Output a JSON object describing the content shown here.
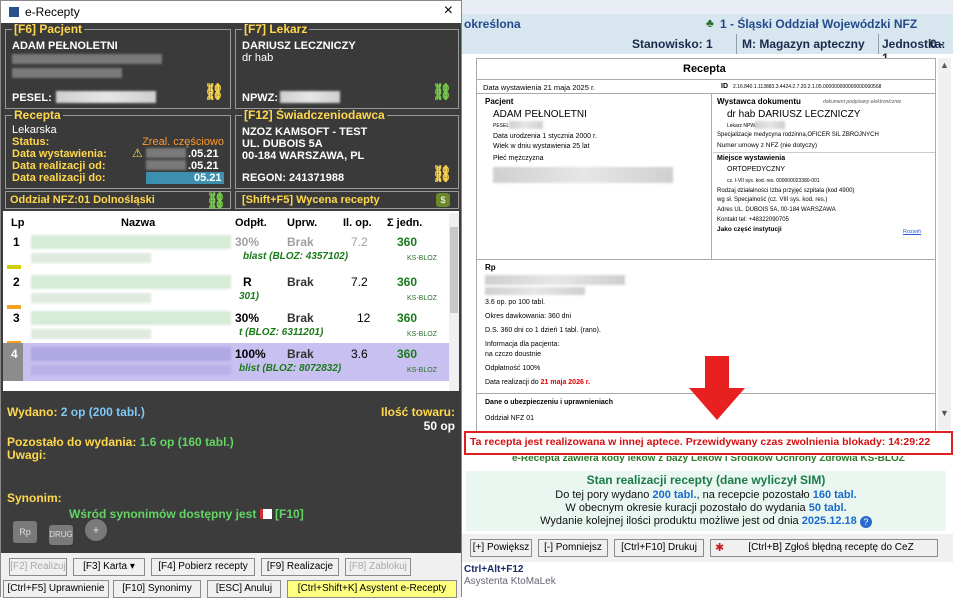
{
  "window": {
    "title": "e-Recepty",
    "close": "×"
  },
  "pacjent": {
    "legend": "[F6] Pacjent",
    "name": "ADAM PEŁNOLETNI",
    "pesel_label": "PESEL:"
  },
  "lekarz": {
    "legend": "[F7] Lekarz",
    "name": "DARIUSZ LECZNICZY",
    "title": "dr hab",
    "npwz_label": "NPWZ:"
  },
  "recepta": {
    "legend": "Recepta",
    "type": "Lekarska",
    "status_label": "Status:",
    "status_value": "Zreal. częściowo",
    "wystawienia_label": "Data wystawienia:",
    "wystawienia_value": ".05.21",
    "od_label": "Data realizacji od:",
    "od_value": ".05.21",
    "do_label": "Data realizacji do:",
    "do_value": "05.21"
  },
  "swiadczeniodawca": {
    "legend": "[F12] Świadczeniodawca",
    "name": "NZOZ KAMSOFT - TEST",
    "street": "UL. DUBOIS 5A",
    "city": "00-184 WARSZAWA, PL",
    "regon": "REGON: 241371988"
  },
  "oddzial": {
    "label": "Oddział NFZ:01 Dolnośląski"
  },
  "wycena": {
    "label": "[Shift+F5] Wycena recepty"
  },
  "table": {
    "headers": {
      "lp": "Lp",
      "nazwa": "Nazwa",
      "odplt": "Odpłt.",
      "uprw": "Uprw.",
      "ilop": "Il. op.",
      "sjedn": "Σ jedn."
    },
    "rows": [
      {
        "lp": "1",
        "odplt": "30%",
        "uprw": "Brak",
        "ilop": "7.2",
        "sjedn": "360",
        "sub": "blast (BLOZ: 4357102)",
        "bloz": "KS-BLOZ"
      },
      {
        "lp": "2",
        "odplt": "R",
        "uprw": "Brak",
        "ilop": "7.2",
        "sjedn": "360",
        "sub": "301)",
        "bloz": "KS-BLOZ"
      },
      {
        "lp": "3",
        "odplt": "30%",
        "uprw": "Brak",
        "ilop": "12",
        "sjedn": "360",
        "sub": "t (BLOZ: 6311201)",
        "bloz": "KS-BLOZ"
      },
      {
        "lp": "4",
        "odplt": "100%",
        "uprw": "Brak",
        "ilop": "3.6",
        "sjedn": "360",
        "sub": "blist (BLOZ: 8072832)",
        "bloz": "KS-BLOZ"
      }
    ]
  },
  "summary": {
    "wydano_label": "Wydano:",
    "wydano_value": "2 op (200 tabl.)",
    "ilosc_label": "Ilość towaru:",
    "ilosc_value": "50 op",
    "pozostalo_label": "Pozostało do wydania:",
    "pozostalo_value": "1.6 op (160 tabl.)",
    "uwagi_label": "Uwagi:",
    "synonim_label": "Synonim:",
    "synonim_text": "Wśród synonimów dostępny jest",
    "synonim_key": "[F10]"
  },
  "buttons_row1": [
    "[F2] Realizuj",
    "[F3] Karta ▾",
    "[F4] Pobierz recepty",
    "[F9] Realizacje",
    "[F8] Zablokuj"
  ],
  "buttons_row2": [
    "[Ctrl+F5] Uprawnienie",
    "[F10] Synonimy",
    "[ESC] Anuluj",
    "[Ctrl+Shift+K] Asystent e-Recepty"
  ],
  "right": {
    "hdr_left": "określona",
    "hdr_nfz": "1 - Śląski Oddział Wojewódzki NFZ",
    "stanowisko": "Stanowisko: 1",
    "magazyn": "M: Magazyn apteczny",
    "jednostka": "Jednostka: 1",
    "jednostka_tail": "0 -"
  },
  "doc": {
    "title": "Recepta",
    "data_wyst": "Data wystawienia 21 maja 2025 r.",
    "id_label": "ID",
    "id_value": "2.16.840.1.113883.3.4424.2.7.20.2.1.05.000000000000000000568",
    "pacjent_h": "Pacjent",
    "pacjent_name": "ADAM PEŁNOLETNI",
    "pesel": "PESEL",
    "ur": "Data urodzenia 1 stycznia 2000 r.",
    "wiek": "Wiek w dniu wystawienia 25 lat",
    "plec": "Płeć mężczyzna",
    "wyst_h": "Wystawca dokumentu",
    "wyst_sig": "dokument podpisany elektronicznie",
    "wyst_name": "dr hab DARIUSZ LECZNICZY",
    "lek_npwz": "Lekarz NPWZ",
    "spec": "Specjalizacje medycyna rodzinna,OFICER SIL ZBROJNYCH",
    "umowa": "Numer umowy z NFZ (nie dotyczy)",
    "miejsce_h": "Miejsce wystawienia",
    "miejsce": "ORTOPEDYCZNY",
    "kod_resort": "cz. I-VII sys. kod. res. 000000023380-001",
    "rodzaj": "Rodzaj działalności Izba przyjęć szpitala (kod 4900)",
    "wg": "wg sł. Specjalność (cz. VIII sys. kod. res.)",
    "adres": "Adres UL. DUBOIS 5A, 00-184 WARSZAWA",
    "kontakt": "Kontakt tel: +48322090705",
    "jako": "Jako część instytucji",
    "rozwin": "Rozwiń",
    "rp": "Rp",
    "op": "3.6 op. po 100 tabl.",
    "okres": "Okres dawkowania: 360 dni",
    "ds": "D.S. 360 dni co 1 dzień 1 tabl. (rano).",
    "info": "Informacja dla pacjenta:",
    "info2": "na czczo doustnie",
    "odplat": "Odpłatność 100%",
    "realiz": "Data realizacji do",
    "realiz_val": "21 maja 2026 r.",
    "ubezp_h": "Dane o ubezpieczeniu i uprawnieniach",
    "oddzial": "Oddział NFZ 01"
  },
  "warning": "Ta recepta jest realizowana w innej aptece. Przewidywany czas zwolnienia blokady: 14:29:22",
  "hidden_line": "e-Recepta zawiera kody leków z bazy Leków i Środków Ochrony Zdrowia KS-BLOZ",
  "status": {
    "title": "Stan realizacji recepty (dane wyliczył SIM)",
    "line1a": "Do tej pory wydano",
    "line1b": "200 tabl.",
    "line1c": ", na recepcie pozostało",
    "line1d": "160 tabl.",
    "line2a": "W obecnym okresie kuracji pozostało do wydania",
    "line2b": "50 tabl.",
    "line3a": "Wydanie kolejnej ilości produktu możliwe jest od dnia",
    "line3b": "2025.12.18"
  },
  "right_buttons": [
    "[+] Powiększ",
    "[-] Pomniejsz",
    "[Ctrl+F10] Drukuj",
    "[Ctrl+B] Zgłoś błędną receptę do CeZ"
  ],
  "footer": {
    "keys": "Ctrl+Alt+F12",
    "name": "Asystenta KtoMaLek"
  },
  "colors": {
    "accent_yellow": "#ffd84d",
    "green": "#65d465",
    "warning_red": "#e02020",
    "date_red": "#e00000"
  }
}
